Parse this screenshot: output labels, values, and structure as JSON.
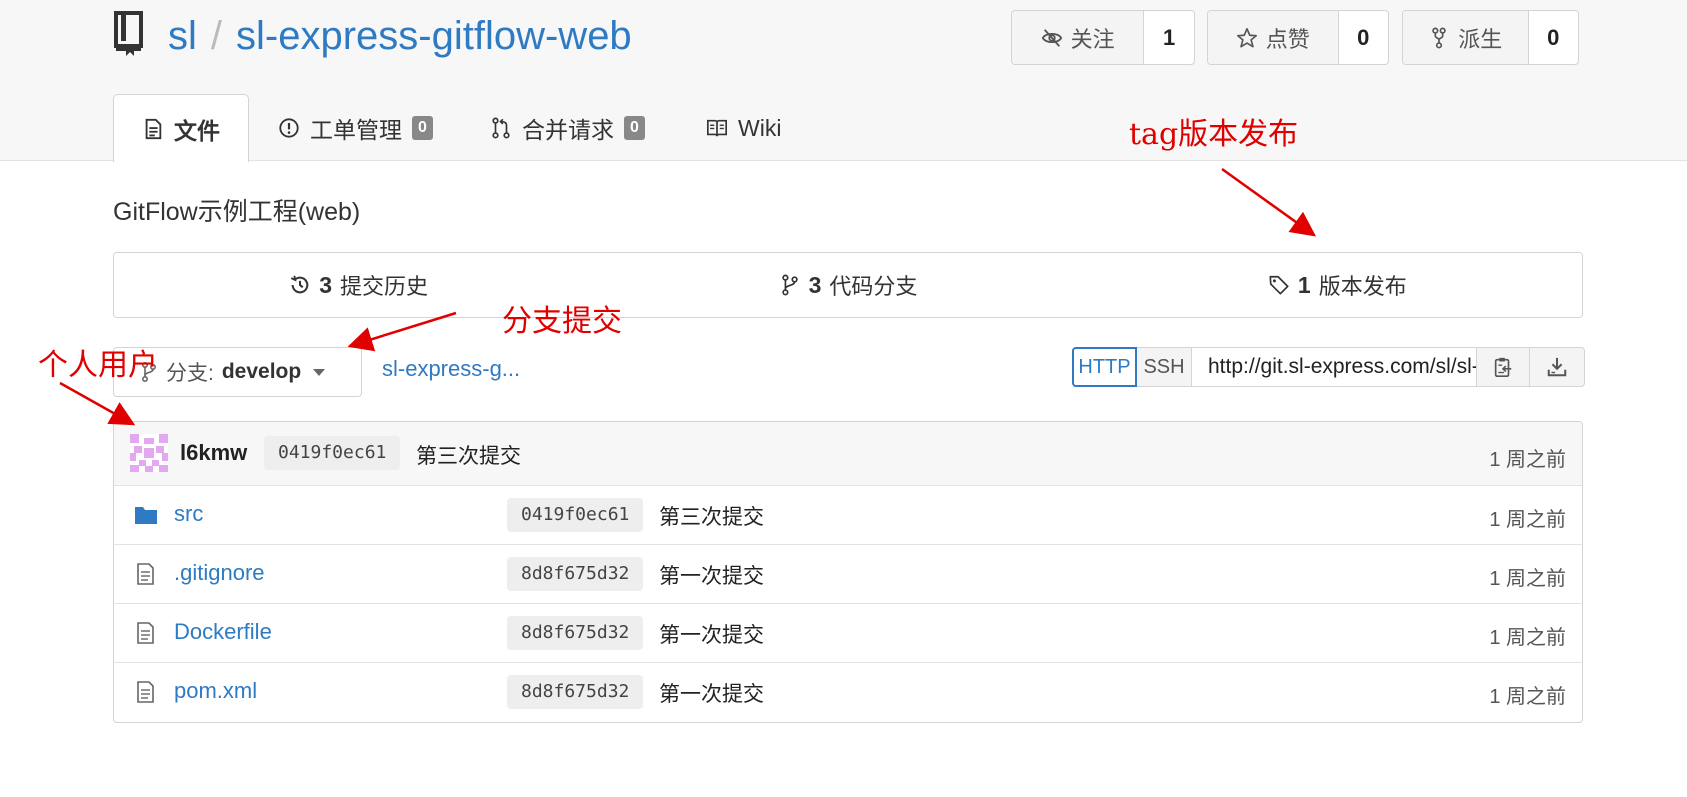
{
  "repo": {
    "owner": "sl",
    "separator": "/",
    "name": "sl-express-gitflow-web",
    "description": "GitFlow示例工程(web)"
  },
  "actions": {
    "watch": {
      "label": "关注",
      "count": "1"
    },
    "star": {
      "label": "点赞",
      "count": "0"
    },
    "fork": {
      "label": "派生",
      "count": "0"
    }
  },
  "tabs": [
    {
      "label": "文件",
      "icon": "file-text-icon",
      "active": true
    },
    {
      "label": "工单管理",
      "badge": "0",
      "icon": "issue-icon"
    },
    {
      "label": "合并请求",
      "badge": "0",
      "icon": "pull-request-icon"
    },
    {
      "label": "Wiki",
      "icon": "book-icon"
    }
  ],
  "stats": {
    "commits": {
      "count": "3",
      "label": "提交历史"
    },
    "branches": {
      "count": "3",
      "label": "代码分支"
    },
    "releases": {
      "count": "1",
      "label": "版本发布"
    }
  },
  "branch": {
    "prefix": "分支:",
    "name": "develop",
    "breadcrumb": "sl-express-g..."
  },
  "clone": {
    "http": "HTTP",
    "ssh": "SSH",
    "url": "http://git.sl-express.com/sl/sl-express-gitflow-web.git"
  },
  "latest_commit": {
    "author": "l6kmw",
    "sha": "0419f0ec61",
    "message": "第三次提交",
    "age": "1 周之前"
  },
  "files": [
    {
      "name": "src",
      "type": "folder",
      "sha": "0419f0ec61",
      "message": "第三次提交",
      "age": "1 周之前"
    },
    {
      "name": ".gitignore",
      "type": "file",
      "sha": "8d8f675d32",
      "message": "第一次提交",
      "age": "1 周之前"
    },
    {
      "name": "Dockerfile",
      "type": "file",
      "sha": "8d8f675d32",
      "message": "第一次提交",
      "age": "1 周之前"
    },
    {
      "name": "pom.xml",
      "type": "file",
      "sha": "8d8f675d32",
      "message": "第一次提交",
      "age": "1 周之前"
    }
  ],
  "annotations": {
    "tag_release": "tag版本发布",
    "branch_commit": "分支提交",
    "personal_user": "个人用户"
  },
  "colors": {
    "link": "#2e7bc4",
    "annotation": "#e00000",
    "header_bg": "#f7f7f7",
    "border": "#d4d4d5",
    "badge": "#888888"
  }
}
